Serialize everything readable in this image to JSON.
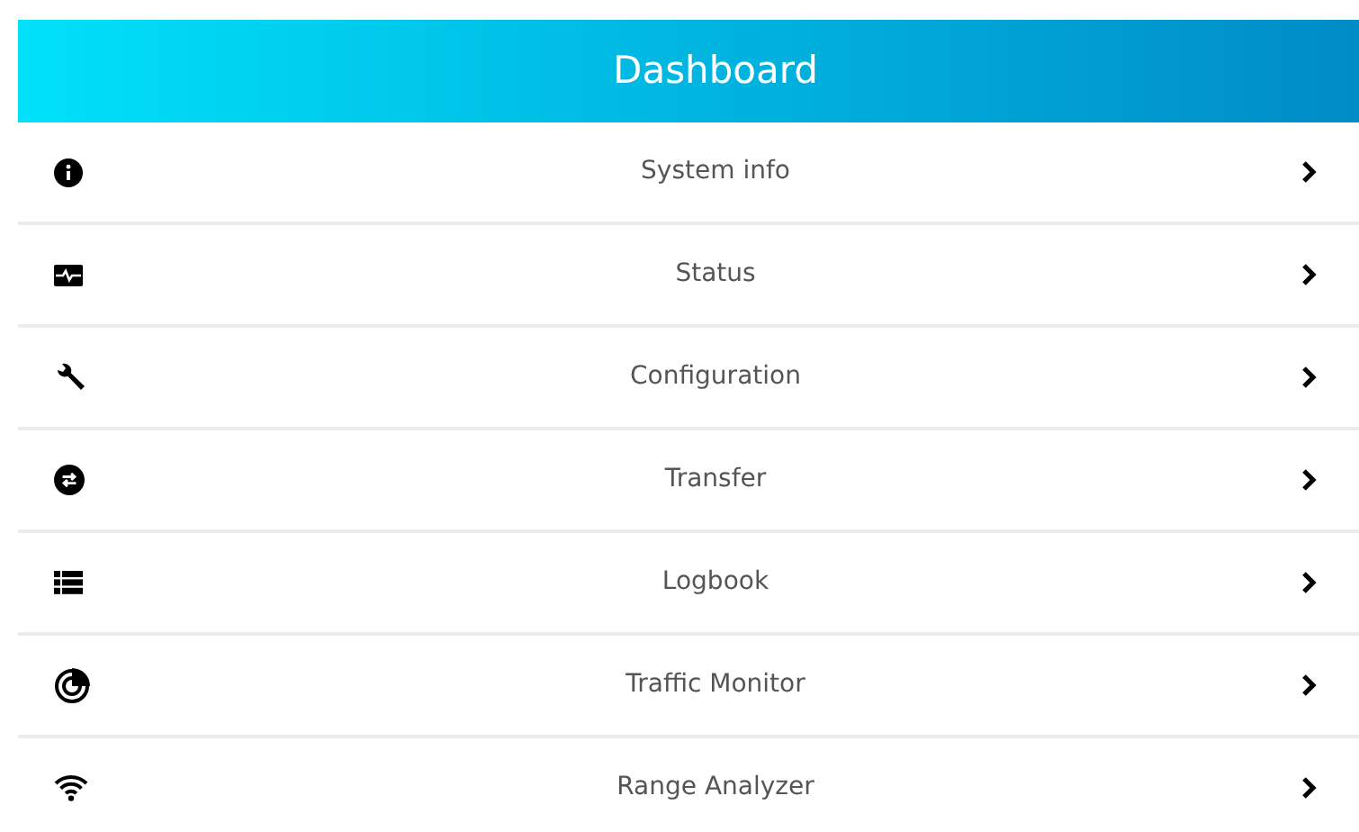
{
  "header": {
    "title": "Dashboard"
  },
  "menu_items": [
    {
      "label": "System info",
      "kind": "info"
    },
    {
      "label": "Status",
      "kind": "status"
    },
    {
      "label": "Configuration",
      "kind": "wrench"
    },
    {
      "label": "Transfer",
      "kind": "transfer"
    },
    {
      "label": "Logbook",
      "kind": "list"
    },
    {
      "label": "Traffic Monitor",
      "kind": "radar"
    },
    {
      "label": "Range Analyzer",
      "kind": "wifi"
    }
  ]
}
